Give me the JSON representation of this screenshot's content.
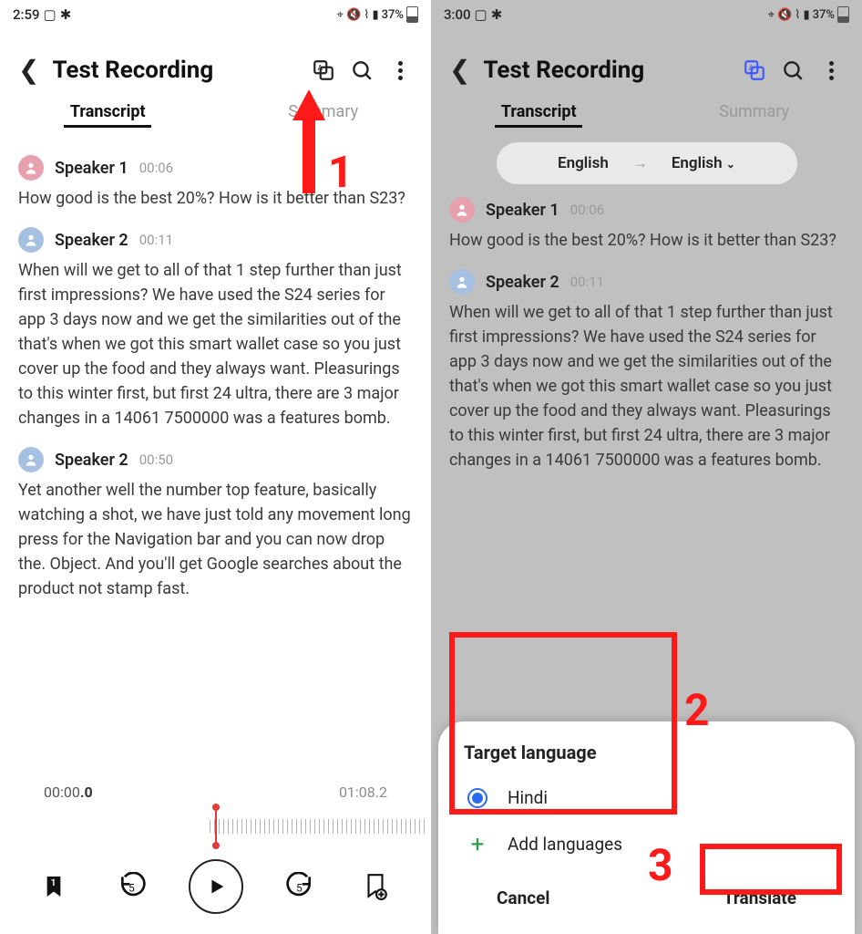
{
  "left": {
    "status": {
      "time": "2:59",
      "battery": "37%"
    },
    "title": "Test Recording",
    "tabs": {
      "transcript": "Transcript",
      "summary": "Summary"
    },
    "entries": [
      {
        "speaker": "Speaker 1",
        "time": "00:06",
        "avatar": "pink",
        "text": "How good is the best 20%? How is it better than S23?"
      },
      {
        "speaker": "Speaker 2",
        "time": "00:11",
        "avatar": "blue",
        "text": "When will we get to all of that 1 step further than just first impressions? We have used the S24 series for app 3 days now and we get the similarities out of the that's when we got this smart wallet case so you just cover up the food and they always want. Pleasurings to this winter first, but first 24 ultra, there are 3 major changes in a 14061 7500000 was a features bomb."
      },
      {
        "speaker": "Speaker 2",
        "time": "00:50",
        "avatar": "blue",
        "text": "Yet another well the number top feature, basically watching a shot, we have just told any movement long press for the Navigation bar and you can now drop the. Object. And you'll get Google searches about the product not stamp fast."
      }
    ],
    "player": {
      "current_whole": "00:00",
      "current_dec": ".0",
      "total": "01:08.2",
      "bookmark_badge": "1"
    },
    "annotation": {
      "num1": "1"
    }
  },
  "right": {
    "status": {
      "time": "3:00",
      "battery": "37%"
    },
    "title": "Test Recording",
    "tabs": {
      "transcript": "Transcript",
      "summary": "Summary"
    },
    "lang_from": "English",
    "lang_to": "English",
    "entries": [
      {
        "speaker": "Speaker 1",
        "time": "00:06",
        "avatar": "pink",
        "text": "How good is the best 20%? How is it better than S23?"
      },
      {
        "speaker": "Speaker 2",
        "time": "00:11",
        "avatar": "blue",
        "text": "When will we get to all of that 1 step further than just first impressions? We have used the S24 series for app 3 days now and we get the similarities out of the that's when we got this smart wallet case so you just cover up the food and they always want. Pleasurings to this winter first, but first 24 ultra, there are 3 major changes in a 14061 7500000 was a features bomb."
      }
    ],
    "sheet": {
      "title": "Target language",
      "option_hindi": "Hindi",
      "option_add": "Add languages",
      "cancel": "Cancel",
      "translate": "Translate"
    },
    "annotation": {
      "num2": "2",
      "num3": "3"
    }
  }
}
